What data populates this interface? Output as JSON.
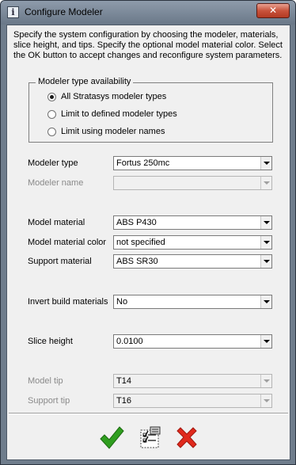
{
  "window": {
    "title": "Configure Modeler",
    "close_label": "✕"
  },
  "description": "Specify the system configuration by choosing the modeler, materials, slice height, and tips. Specify the optional model material color. Select the OK button to accept changes and reconfigure system parameters.",
  "modeler_type_availability": {
    "legend": "Modeler type availability",
    "options": [
      {
        "label": "All Stratasys modeler types",
        "checked": true
      },
      {
        "label": "Limit to defined modeler types",
        "checked": false
      },
      {
        "label": "Limit using modeler names",
        "checked": false
      }
    ]
  },
  "fields": {
    "modeler_type": {
      "label": "Modeler type",
      "value": "Fortus 250mc",
      "enabled": true
    },
    "modeler_name": {
      "label": "Modeler name",
      "value": "",
      "enabled": false
    },
    "model_material": {
      "label": "Model material",
      "value": "ABS P430",
      "enabled": true
    },
    "model_material_color": {
      "label": "Model material color",
      "value": "not specified",
      "enabled": true
    },
    "support_material": {
      "label": "Support material",
      "value": "ABS SR30",
      "enabled": true
    },
    "invert_build_materials": {
      "label": "Invert build materials",
      "value": "No",
      "enabled": true
    },
    "slice_height": {
      "label": "Slice height",
      "value": "0.0100",
      "enabled": true
    },
    "model_tip": {
      "label": "Model tip",
      "value": "T14",
      "enabled": false
    },
    "support_tip": {
      "label": "Support tip",
      "value": "T16",
      "enabled": false
    }
  },
  "buttons": {
    "ok": {
      "icon": "green-checkmark-icon"
    },
    "configure": {
      "icon": "checklist-icon"
    },
    "cancel": {
      "icon": "red-x-icon"
    }
  },
  "colors": {
    "ok_green": "#2f9e1f",
    "cancel_red": "#e0291c",
    "title_bar": "#7c8999"
  }
}
